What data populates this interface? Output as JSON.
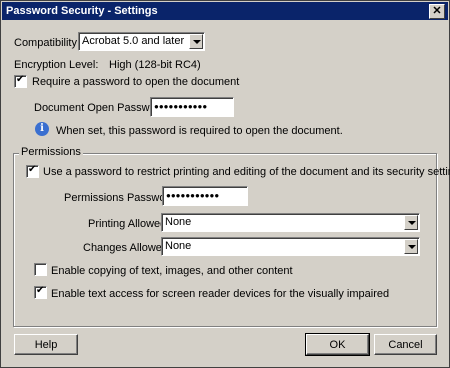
{
  "window": {
    "title": "Password Security - Settings",
    "close_glyph": "✕"
  },
  "compatibility": {
    "label": "Compatibility:",
    "value": "Acrobat 5.0 and later"
  },
  "encryption": {
    "label": "Encryption  Level:",
    "value": "High (128-bit RC4)"
  },
  "open_password": {
    "require_label": "Require a password to open the document",
    "require_checked": true,
    "field_label": "Document Open Password:",
    "field_value": "●●●●●●●●●●●",
    "info_glyph": "i",
    "info_text": "When set, this password is required to open the document."
  },
  "permissions": {
    "group_label": "Permissions",
    "restrict_label": "Use a password to restrict printing and editing of the document and its security settings",
    "restrict_checked": true,
    "password_label": "Permissions Password:",
    "password_value": "●●●●●●●●●●●",
    "printing_label": "Printing Allowed:",
    "printing_value": "None",
    "changes_label": "Changes Allowed:",
    "changes_value": "None",
    "copy_label": "Enable copying of text, images, and other content",
    "copy_checked": false,
    "access_label": "Enable text access for screen reader devices for the visually impaired",
    "access_checked": true
  },
  "buttons": {
    "help": "Help",
    "ok": "OK",
    "cancel": "Cancel"
  },
  "colors": {
    "titlebar": "#0a246a",
    "face": "#d4d0c8",
    "info_icon": "#3a6fd0"
  }
}
